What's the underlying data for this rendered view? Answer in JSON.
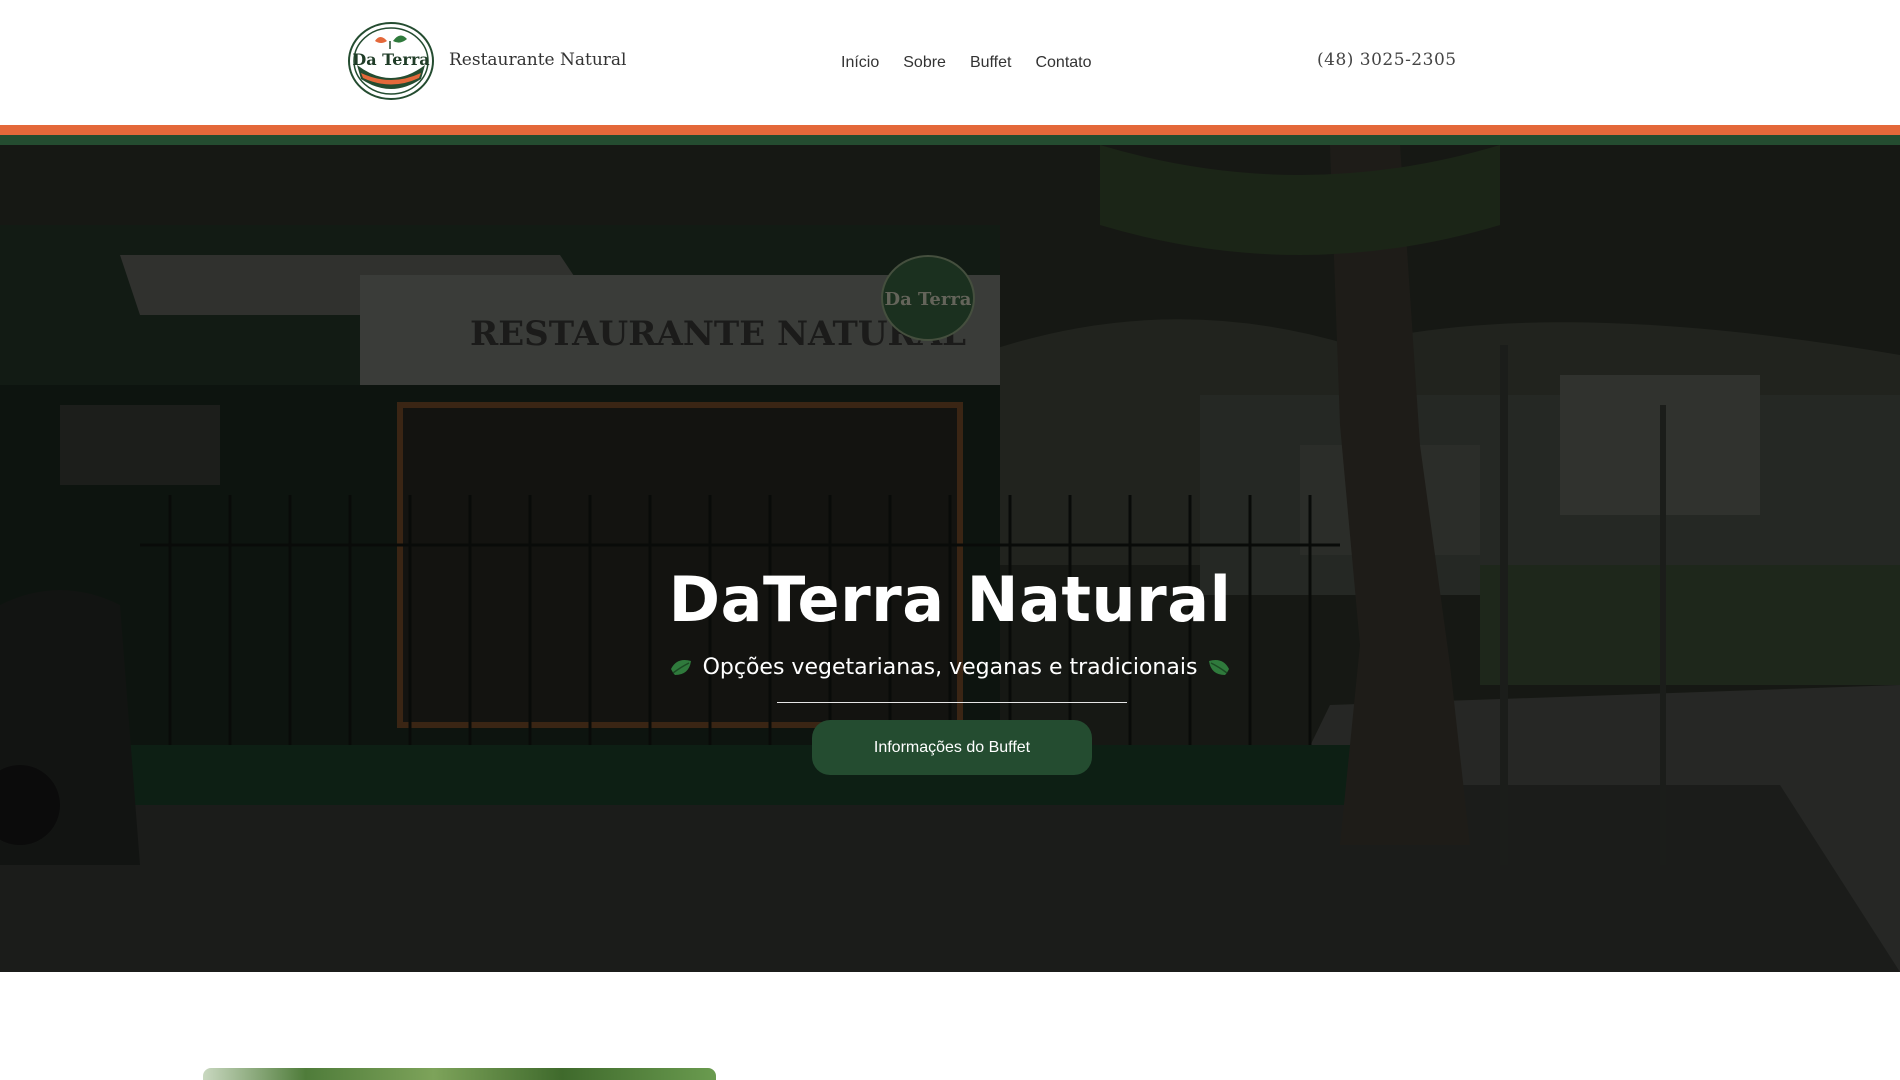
{
  "header": {
    "logo_text": "Da Terra",
    "brand_subtitle": "Restaurante Natural",
    "nav": [
      {
        "label": "Início"
      },
      {
        "label": "Sobre"
      },
      {
        "label": "Buffet"
      },
      {
        "label": "Contato"
      }
    ],
    "phone": "(48) 3025-2305"
  },
  "stripes": {
    "top_color": "#e4683a",
    "bottom_color": "#244c30"
  },
  "hero": {
    "title": "DaTerra Natural",
    "subtitle": "Opções vegetarianas, veganas e tradicionais",
    "cta_label": "Informações do Buffet",
    "background_sign_text": "RESTAURANTE NATURAL",
    "background_logo_text": "Da Terra",
    "leaf_icon_color": "#2f7a3c",
    "button_color": "#244c30"
  }
}
